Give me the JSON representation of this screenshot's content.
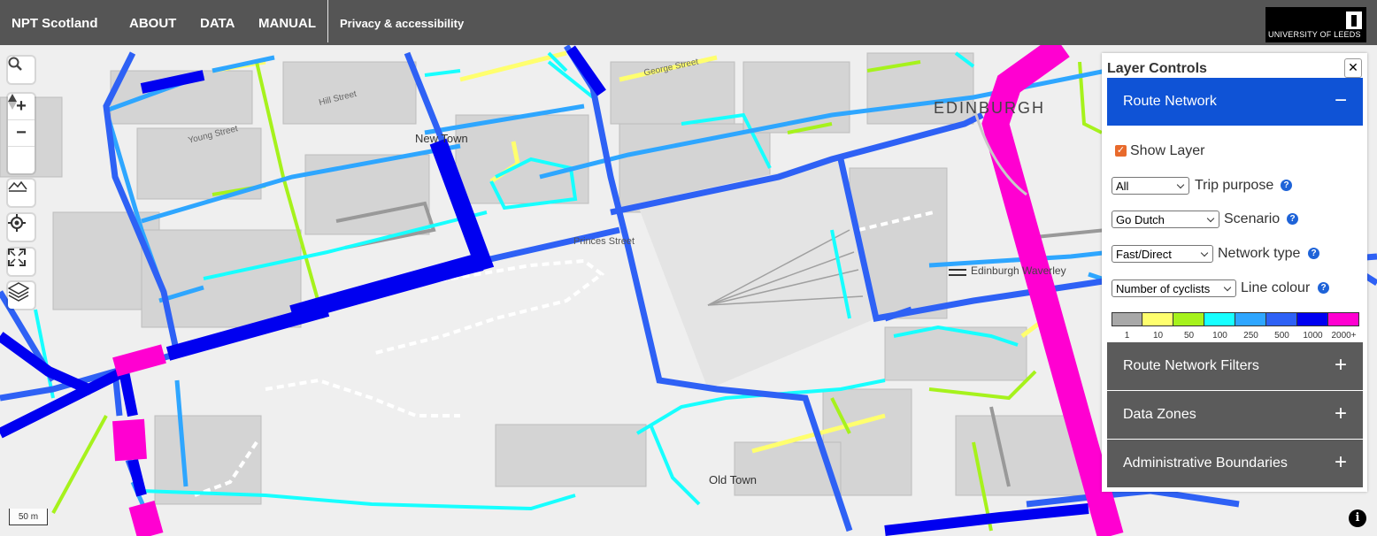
{
  "header": {
    "brand": "NPT Scotland",
    "nav": [
      "ABOUT",
      "DATA",
      "MANUAL"
    ],
    "privacy": "Privacy & accessibility",
    "logo_text": "UNIVERSITY OF LEEDS"
  },
  "map": {
    "labels": {
      "new_town": "New Town",
      "old_town": "Old Town",
      "edinburgh": "EDINBURGH",
      "waverley": "Edinburgh Waverley",
      "george_street": "George Street",
      "hill_street": "Hill Street",
      "young_street": "Young Street",
      "princes_street": "Princes Street"
    },
    "scale": "50 m",
    "info_icon": "i"
  },
  "controls": {
    "search": "search-icon",
    "zoom_in": "+",
    "zoom_out": "−",
    "compass": "compass-icon",
    "terrain": "terrain-icon",
    "geolocate": "geolocate-icon",
    "fullscreen": "fullscreen-icon",
    "layers": "layers-icon"
  },
  "panel": {
    "title": "Layer Controls",
    "close": "✕",
    "route_network": {
      "label": "Route Network",
      "sign": "−",
      "show_layer": "Show Layer",
      "show_layer_checked": true,
      "trip_purpose": {
        "value": "All",
        "label": "Trip purpose"
      },
      "scenario": {
        "value": "Go Dutch",
        "label": "Scenario"
      },
      "network_type": {
        "value": "Fast/Direct",
        "label": "Network type"
      },
      "line_colour": {
        "value": "Number of cyclists",
        "label": "Line colour"
      },
      "help": "?"
    },
    "legend": {
      "colors": [
        "#a8a8a8",
        "#ffff6e",
        "#a6f21c",
        "#17ffff",
        "#2ea6ff",
        "#2e61f5",
        "#0000f0",
        "#ff00d1"
      ],
      "labels": [
        "1",
        "10",
        "50",
        "100",
        "250",
        "500",
        "1000",
        "2000+"
      ]
    },
    "sections": [
      {
        "label": "Route Network Filters",
        "sign": "+"
      },
      {
        "label": "Data Zones",
        "sign": "+"
      },
      {
        "label": "Administrative Boundaries",
        "sign": "+"
      }
    ],
    "colors": {
      "active": "#0f53d6",
      "inactive": "#5b5b5b"
    }
  }
}
